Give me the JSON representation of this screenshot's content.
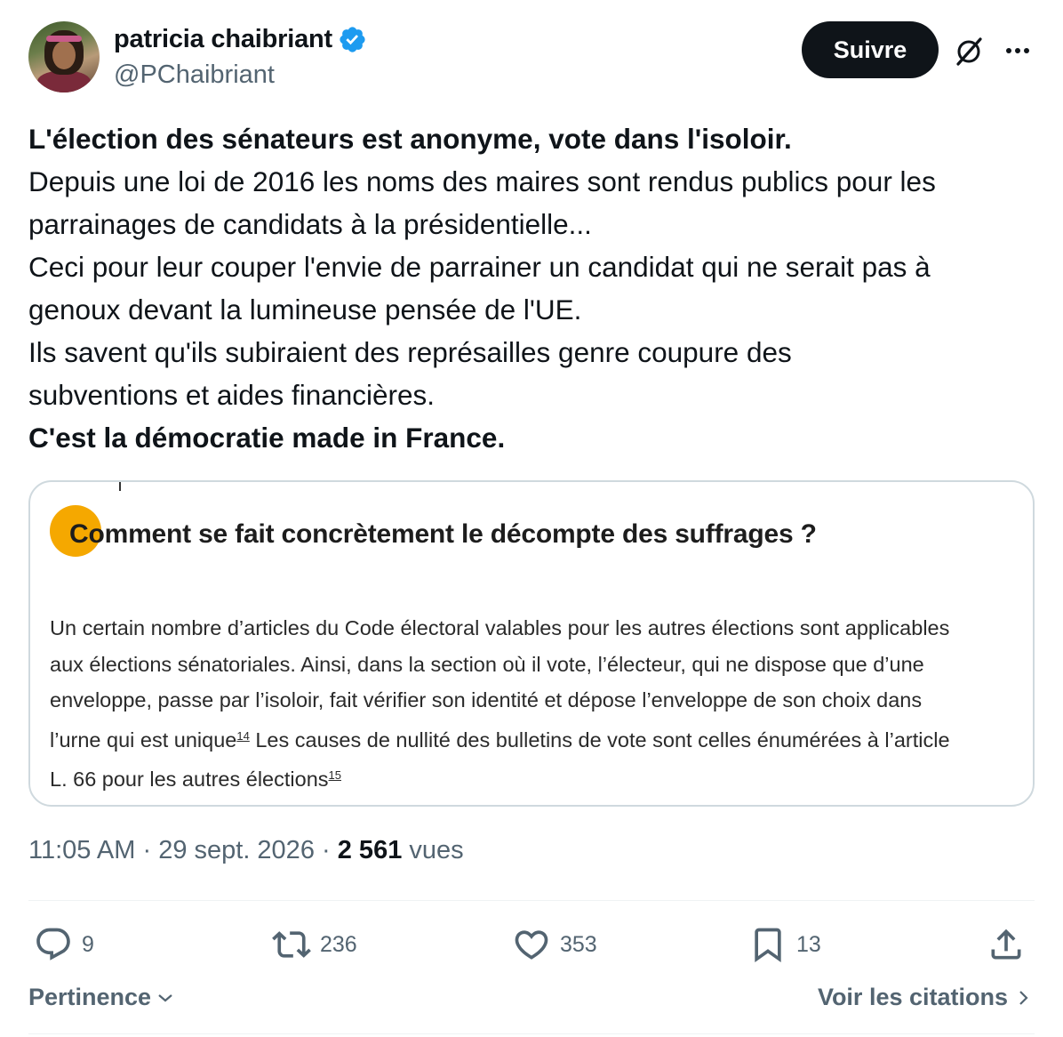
{
  "author": {
    "display_name": "patricia chaibriant",
    "handle": "@PChaibriant",
    "verified": true
  },
  "header": {
    "follow_label": "Suivre"
  },
  "tweet": {
    "lines": [
      "L'élection des sénateurs est anonyme, vote dans l'isoloir.",
      "Depuis une loi de 2016 les noms des maires sont rendus publics pour les",
      "parrainages de candidats à la présidentielle...",
      "Ceci pour leur couper l'envie de parrainer un candidat qui ne serait pas à",
      "genoux devant la lumineuse pensée de l'UE.",
      "Ils savent qu'ils subiraient des représailles genre coupure des",
      "subventions et aides financières.",
      "C'est la démocratie made in France."
    ]
  },
  "media": {
    "title": "Comment se fait concrètement le décompte des suffrages ?",
    "body_lines": [
      "Un certain nombre d’articles du Code électoral valables pour les autres élections sont applicables",
      "aux élections sénatoriales. Ainsi, dans la section où il vote, l’électeur, qui ne dispose que d’une",
      "enveloppe, passe par l’isoloir, fait vérifier son identité et dépose l’enveloppe de son choix dans",
      "l’urne qui est unique",
      "Les causes de nullité des bulletins de vote sont celles énumérées à l’article",
      "L. 66 pour les autres élections"
    ],
    "footnote_14": "14",
    "footnote_15": "15"
  },
  "meta": {
    "time": "11:05 AM",
    "separator": "·",
    "date": "29 sept. 2026",
    "views_count": "2 561",
    "views_label": "vues"
  },
  "actions": {
    "replies": "9",
    "reposts": "236",
    "likes": "353",
    "bookmarks": "13"
  },
  "footer": {
    "sort_label": "Pertinence",
    "citations_label": "Voir les citations"
  },
  "colors": {
    "text": "#0f1419",
    "secondary": "#536471",
    "verified": "#1d9bf0",
    "border": "#cfd9de",
    "accent_dot": "#f5a800"
  }
}
